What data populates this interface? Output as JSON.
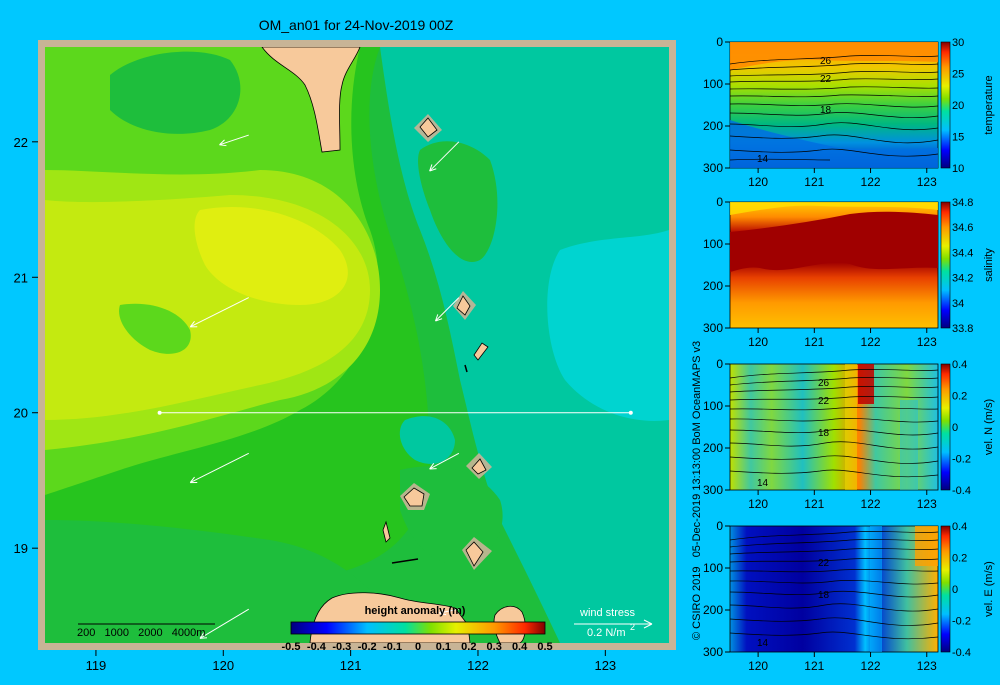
{
  "title": "OM_an01 for 24-Nov-2019 00Z",
  "credit": "© CSIRO 2019   05-Dec-2019 13:13:00 BoM OceanMAPS v3",
  "colors": {
    "background": "#00c8ff",
    "land": "#f7c99b",
    "frame": "#c8b496",
    "vectors": "#ffffff"
  },
  "chart_data": [
    {
      "type": "heatmap",
      "name": "map",
      "xlim": [
        118.6,
        123.5
      ],
      "ylim": [
        18.3,
        22.7
      ],
      "x_ticks": [
        "119",
        "120",
        "121",
        "122",
        "123"
      ],
      "y_ticks": [
        "19",
        "20",
        "21",
        "22"
      ],
      "colorbar": {
        "label": "height anomaly  (m)",
        "ticks": [
          "-0.5",
          "-0.4",
          "-0.3",
          "-0.2",
          "-0.1",
          "0",
          "0.1",
          "0.2",
          "0.3",
          "0.4",
          "0.5"
        ],
        "range": [
          -0.5,
          0.5
        ]
      },
      "section_line": {
        "from": [
          119.5,
          20.0
        ],
        "to": [
          123.2,
          20.0
        ]
      },
      "depth_scale_label": "200   1000   2000   4000m",
      "wind_stress": {
        "label": "wind stress",
        "scale_label": "0.2 N/m",
        "superscript": "2"
      },
      "wind_vectors": [
        {
          "lon": 120.2,
          "lat": 22.05,
          "u": -0.15,
          "v": -0.05
        },
        {
          "lon": 121.85,
          "lat": 22.0,
          "u": -0.15,
          "v": -0.15
        },
        {
          "lon": 120.2,
          "lat": 20.85,
          "u": -0.3,
          "v": -0.15
        },
        {
          "lon": 121.85,
          "lat": 20.85,
          "u": -0.12,
          "v": -0.12
        },
        {
          "lon": 120.2,
          "lat": 19.7,
          "u": -0.3,
          "v": -0.15
        },
        {
          "lon": 121.85,
          "lat": 19.7,
          "u": -0.15,
          "v": -0.08
        },
        {
          "lon": 120.2,
          "lat": 18.55,
          "u": -0.25,
          "v": -0.15
        },
        {
          "lon": 121.85,
          "lat": 18.55,
          "u": -0.1,
          "v": -0.02
        }
      ]
    },
    {
      "type": "heatmap",
      "name": "temperature-section",
      "xlim": [
        119.5,
        123.2
      ],
      "ylim": [
        300,
        0
      ],
      "x_ticks": [
        "120",
        "121",
        "122",
        "123"
      ],
      "y_ticks": [
        "0",
        "100",
        "200",
        "300"
      ],
      "colorbar": {
        "label": "temperature",
        "ticks": [
          "30",
          "25",
          "20",
          "15",
          "10"
        ],
        "range": [
          10,
          30
        ]
      },
      "contour_labels": [
        "26",
        "22",
        "18",
        "14"
      ]
    },
    {
      "type": "heatmap",
      "name": "salinity-section",
      "xlim": [
        119.5,
        123.2
      ],
      "ylim": [
        300,
        0
      ],
      "x_ticks": [
        "120",
        "121",
        "122",
        "123"
      ],
      "y_ticks": [
        "0",
        "100",
        "200",
        "300"
      ],
      "colorbar": {
        "label": "salinity",
        "ticks": [
          "34.8",
          "34.6",
          "34.4",
          "34.2",
          "34",
          "33.8"
        ],
        "range": [
          33.8,
          34.8
        ]
      }
    },
    {
      "type": "heatmap",
      "name": "vel-n-section",
      "xlim": [
        119.5,
        123.2
      ],
      "ylim": [
        300,
        0
      ],
      "x_ticks": [
        "120",
        "121",
        "122",
        "123"
      ],
      "y_ticks": [
        "0",
        "100",
        "200",
        "300"
      ],
      "colorbar": {
        "label": "vel. N  (m/s)",
        "ticks": [
          "0.4",
          "0.2",
          "0",
          "-0.2",
          "-0.4"
        ],
        "range": [
          -0.4,
          0.4
        ]
      },
      "contour_labels": [
        "26",
        "22",
        "18",
        "14"
      ]
    },
    {
      "type": "heatmap",
      "name": "vel-e-section",
      "xlim": [
        119.5,
        123.2
      ],
      "ylim": [
        300,
        0
      ],
      "x_ticks": [
        "120",
        "121",
        "122",
        "123"
      ],
      "y_ticks": [
        "0",
        "100",
        "200",
        "300"
      ],
      "colorbar": {
        "label": "vel. E  (m/s)",
        "ticks": [
          "0.4",
          "0.2",
          "0",
          "-0.2",
          "-0.4"
        ],
        "range": [
          -0.4,
          0.4
        ]
      },
      "contour_labels": [
        "22",
        "18",
        "14"
      ]
    }
  ]
}
